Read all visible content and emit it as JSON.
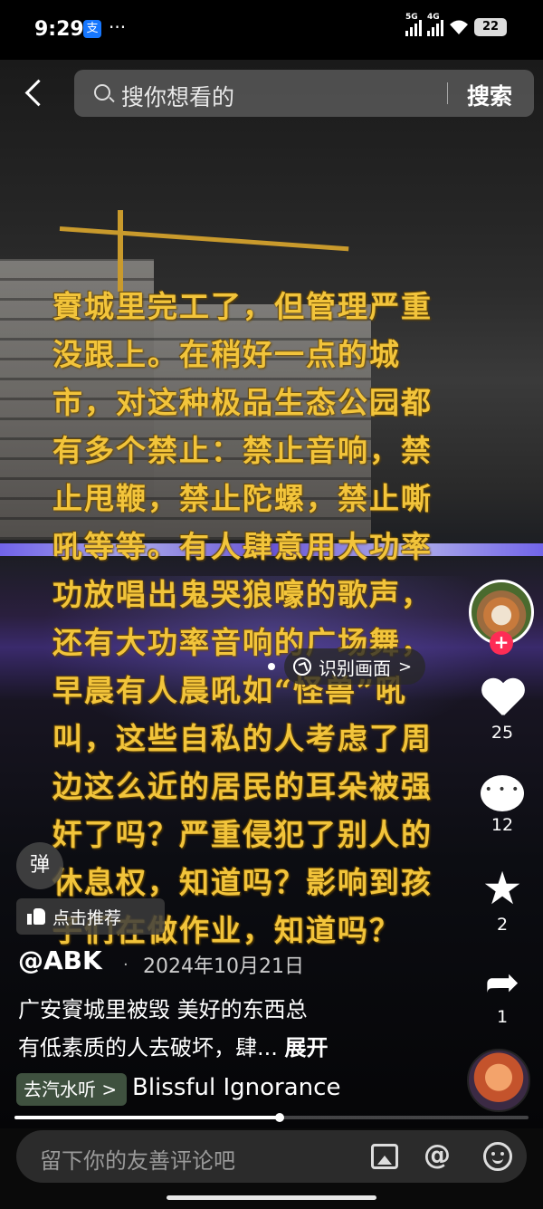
{
  "status_bar": {
    "time": "9:29",
    "alipay_glyph": "支",
    "more": "···",
    "signal_5g": "5G",
    "signal_4g": "4G",
    "battery": "22"
  },
  "search": {
    "placeholder": "搜你想看的",
    "button_label": "搜索"
  },
  "overlay_text": "賨城里完工了，但管理严重\n没跟上。在稍好一点的城\n市，对这种极品生态公园都\n有多个禁止：禁止音响，禁\n止甩鞭，禁止陀螺，禁止嘶\n吼等等。有人肆意用大功率\n功放唱出鬼哭狼嚎的歌声，\n还有大功率音响的广场舞，\n早晨有人晨吼如“怪兽”吼\n叫，这些自私的人考虑了周\n边这么近的居民的耳朵被强\n奸了吗？严重侵犯了别人的\n休息权，知道吗？影响到孩\n子们在做作业，知道吗？",
  "identify": {
    "label": "识别画面",
    "chevron": ">"
  },
  "actions": {
    "follow": "+",
    "likes": "25",
    "comments": "12",
    "favorites": "2",
    "shares": "1"
  },
  "danmu_label": "弹",
  "recommend_label": "点击推荐",
  "post": {
    "author": "@ABK",
    "dot": "·",
    "date": "2024年10月21日",
    "caption_line1": "广安賨城里被毁 美好的东西总",
    "caption_line2": "有低素质的人去破坏，肆...",
    "expand": "展开"
  },
  "music": {
    "chip_label": "去汽水听 >",
    "title": "Blissful Ignorance"
  },
  "progress": {
    "fraction": 0.516
  },
  "comment_bar": {
    "placeholder": "留下你的友善评论吧",
    "at_symbol": "@"
  },
  "icons": {
    "back": "chevron-left-icon",
    "search": "search-icon",
    "like": "heart-icon",
    "comment": "comment-bubble-icon",
    "favorite": "star-icon",
    "share": "share-arrow-icon",
    "image": "image-icon",
    "emoji": "emoji-icon"
  },
  "colors": {
    "overlay_text": "#f2c43b",
    "follow": "#fe2c55",
    "music_chip": "#465a46"
  }
}
